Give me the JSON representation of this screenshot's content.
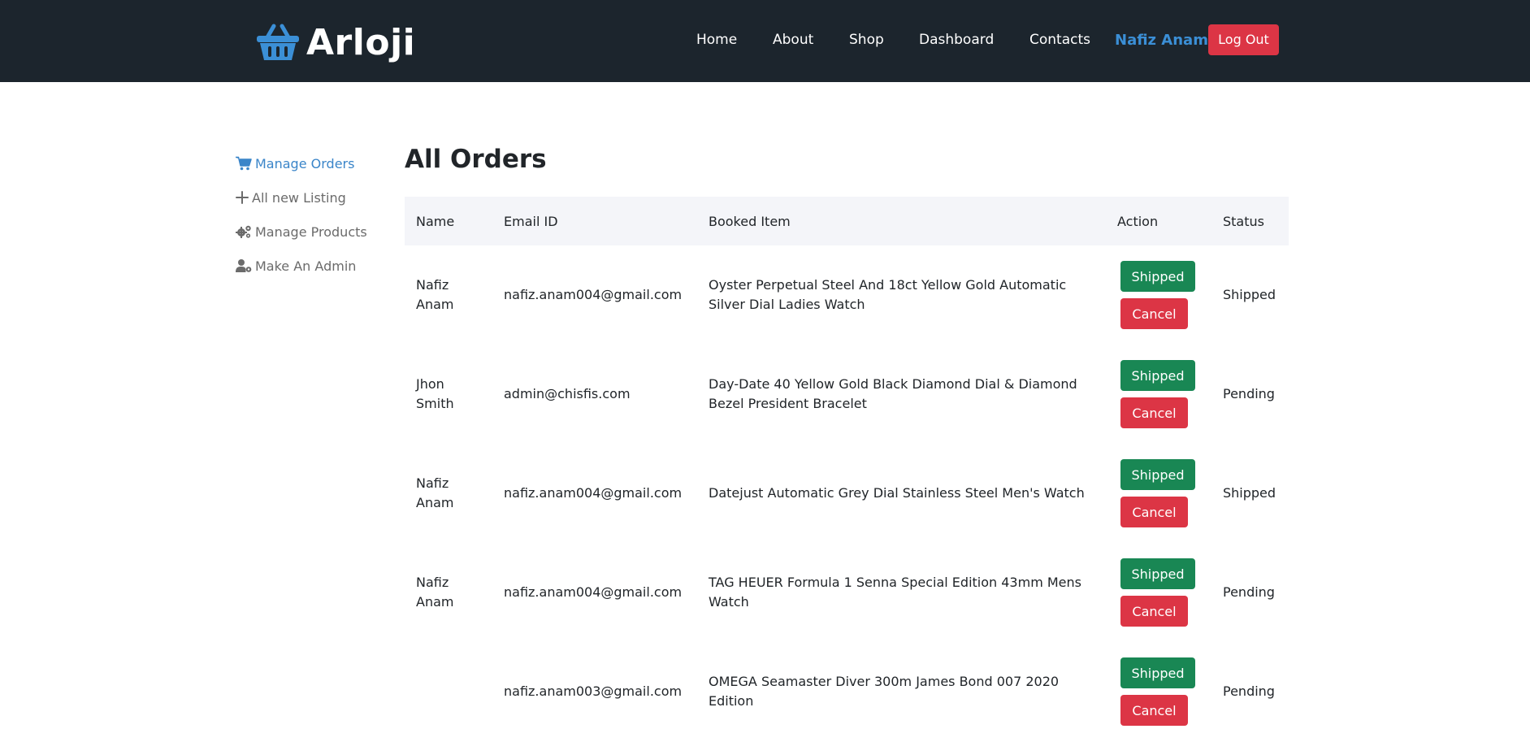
{
  "header": {
    "brand": "Arloji",
    "nav": [
      "Home",
      "About",
      "Shop",
      "Dashboard",
      "Contacts"
    ],
    "user_name": "Nafiz Anam",
    "logout_label": "Log Out"
  },
  "colors": {
    "header_bg": "#1c252d",
    "accent_blue": "#3b8fd6",
    "success": "#198754",
    "danger": "#dc3545",
    "table_header_bg": "#f4f5f9"
  },
  "sidebar": {
    "items": [
      {
        "label": "Manage Orders",
        "icon": "shopping-cart-icon",
        "active": true
      },
      {
        "label": "All new Listing",
        "icon": "plus-icon",
        "active": false
      },
      {
        "label": "Manage Products",
        "icon": "gears-icon",
        "active": false
      },
      {
        "label": "Make An Admin",
        "icon": "user-gear-icon",
        "active": false
      }
    ]
  },
  "main": {
    "title": "All Orders",
    "columns": [
      "Name",
      "Email ID",
      "Booked Item",
      "Action",
      "Status"
    ],
    "shipped_label": "Shipped",
    "cancel_label": "Cancel",
    "rows": [
      {
        "name": "Nafiz Anam",
        "email": "nafiz.anam004@gmail.com",
        "item": "Oyster Perpetual Steel And 18ct Yellow Gold Automatic Silver Dial Ladies Watch",
        "status": "Shipped"
      },
      {
        "name": "Jhon Smith",
        "email": "admin@chisfis.com",
        "item": "Day-Date 40 Yellow Gold Black Diamond Dial & Diamond Bezel President Bracelet",
        "status": "Pending"
      },
      {
        "name": "Nafiz Anam",
        "email": "nafiz.anam004@gmail.com",
        "item": "Datejust Automatic Grey Dial Stainless Steel Men's Watch",
        "status": "Shipped"
      },
      {
        "name": "Nafiz Anam",
        "email": "nafiz.anam004@gmail.com",
        "item": "TAG HEUER Formula 1 Senna Special Edition 43mm Mens Watch",
        "status": "Pending"
      },
      {
        "name": "",
        "email": "nafiz.anam003@gmail.com",
        "item": "OMEGA Seamaster Diver 300m James Bond 007 2020 Edition",
        "status": "Pending"
      }
    ]
  }
}
